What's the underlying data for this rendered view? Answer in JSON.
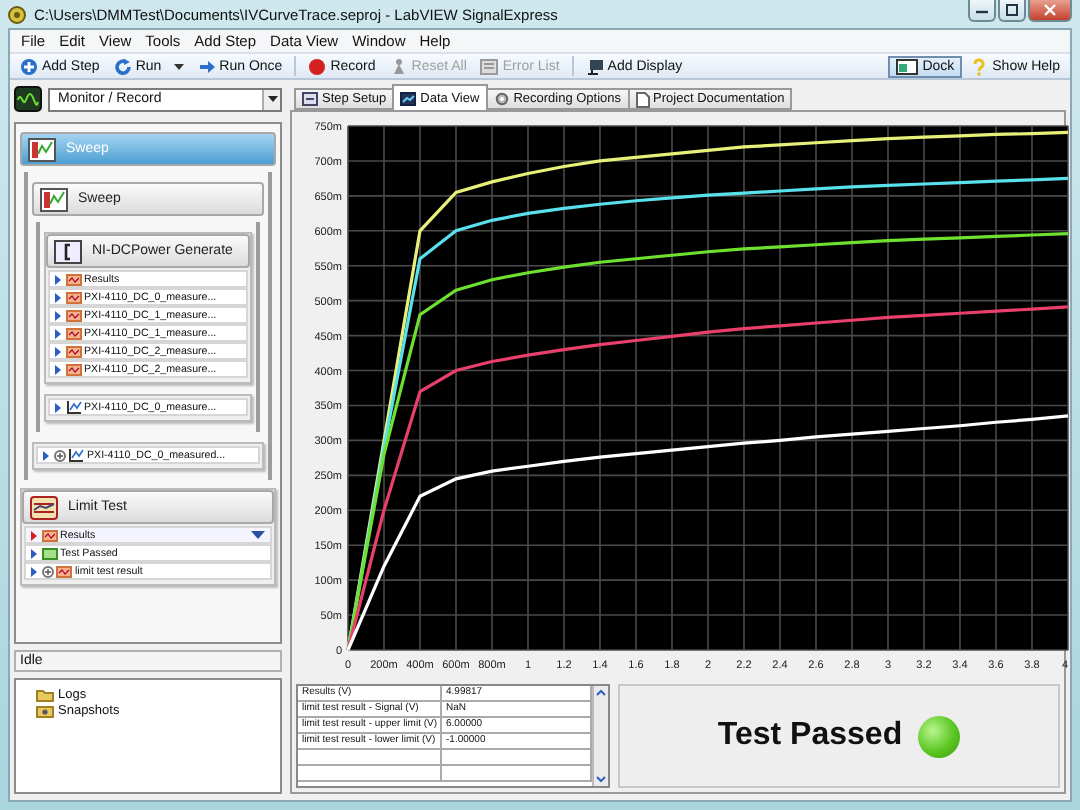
{
  "window": {
    "title": "C:\\Users\\DMMTest\\Documents\\IVCurveTrace.seproj - LabVIEW SignalExpress"
  },
  "menu": [
    "File",
    "Edit",
    "View",
    "Tools",
    "Add Step",
    "Data View",
    "Window",
    "Help"
  ],
  "toolbar": [
    {
      "label": "Add Step",
      "kind": "add",
      "disabled": false,
      "dropdown": false
    },
    {
      "label": "Run",
      "kind": "run",
      "disabled": false,
      "dropdown": true
    },
    {
      "label": "Run Once",
      "kind": "once",
      "disabled": false,
      "dropdown": false
    },
    {
      "label": "Record",
      "kind": "record",
      "disabled": false,
      "dropdown": false
    },
    {
      "label": "Reset All",
      "kind": "reset",
      "disabled": true,
      "dropdown": false
    },
    {
      "label": "Error List",
      "kind": "errors",
      "disabled": true,
      "dropdown": false
    },
    {
      "label": "Add Display",
      "kind": "display",
      "disabled": false,
      "dropdown": false
    }
  ],
  "toolbar_right": [
    {
      "label": "Dock",
      "kind": "dock",
      "pressed": true
    },
    {
      "label": "Show Help",
      "kind": "help",
      "pressed": false
    }
  ],
  "mode": {
    "value": "Monitor / Record"
  },
  "project_tree": {
    "steps": [
      {
        "title": "Sweep",
        "kind": "loop",
        "selected": true,
        "children": [
          {
            "title": "Sweep",
            "kind": "loop",
            "selected": false,
            "children": [
              {
                "title": "NI-DCPower Generate",
                "kind": "dcpower",
                "selected": false,
                "outputs": [
                  {
                    "label": "Results",
                    "kind": "signal",
                    "expandable": false,
                    "selected": false
                  },
                  {
                    "label": "PXI-4110_DC_0_measure...",
                    "kind": "signal",
                    "expandable": false,
                    "selected": false
                  },
                  {
                    "label": "PXI-4110_DC_1_measure...",
                    "kind": "signal",
                    "expandable": false,
                    "selected": false
                  },
                  {
                    "label": "PXI-4110_DC_1_measure...",
                    "kind": "signal",
                    "expandable": false,
                    "selected": false
                  },
                  {
                    "label": "PXI-4110_DC_2_measure...",
                    "kind": "signal",
                    "expandable": false,
                    "selected": false
                  },
                  {
                    "label": "PXI-4110_DC_2_measure...",
                    "kind": "signal",
                    "expandable": false,
                    "selected": false
                  }
                ]
              }
            ],
            "outputs": [
              {
                "label": "PXI-4110_DC_0_measure...",
                "kind": "graph",
                "expandable": false,
                "selected": false
              }
            ]
          }
        ],
        "outputs": [
          {
            "label": "PXI-4110_DC_0_measured...",
            "kind": "graph",
            "expandable": true,
            "selected": false
          }
        ]
      },
      {
        "title": "Limit Test",
        "kind": "limit",
        "selected": false,
        "outputs": [
          {
            "label": "Results",
            "kind": "signal",
            "expandable": false,
            "selected": true
          },
          {
            "label": "Test Passed",
            "kind": "boolean",
            "expandable": false,
            "selected": false
          },
          {
            "label": "limit test result",
            "kind": "signal",
            "expandable": true,
            "selected": false
          }
        ]
      }
    ]
  },
  "status": "Idle",
  "bottom_pane": [
    {
      "label": "Logs",
      "kind": "logs"
    },
    {
      "label": "Snapshots",
      "kind": "snapshots"
    }
  ],
  "tabs": [
    {
      "label": "Step Setup",
      "selected": false
    },
    {
      "label": "Data View",
      "selected": true
    },
    {
      "label": "Recording Options",
      "selected": false
    },
    {
      "label": "Project Documentation",
      "selected": false
    }
  ],
  "chart_data": {
    "type": "line",
    "grid": true,
    "ylim": [
      0,
      750
    ],
    "categories": [
      "0",
      "200m",
      "400m",
      "600m",
      "800m",
      "1",
      "1.2",
      "1.4",
      "1.6",
      "1.8",
      "2",
      "2.2",
      "2.4",
      "2.6",
      "2.8",
      "3",
      "3.2",
      "3.4",
      "3.6",
      "3.8",
      "4"
    ],
    "yticks": [
      0,
      {
        "value": 50,
        "label": "50m"
      },
      {
        "value": 100,
        "label": "100m"
      },
      {
        "value": 150,
        "label": "150m"
      },
      {
        "value": 200,
        "label": "200m"
      },
      {
        "value": 250,
        "label": "250m"
      },
      {
        "value": 300,
        "label": "300m"
      },
      {
        "value": 350,
        "label": "350m"
      },
      {
        "value": 400,
        "label": "400m"
      },
      {
        "value": 450,
        "label": "450m"
      },
      {
        "value": 500,
        "label": "500m"
      },
      {
        "value": 550,
        "label": "550m"
      },
      {
        "value": 600,
        "label": "600m"
      },
      {
        "value": 650,
        "label": "650m"
      },
      {
        "value": 700,
        "label": "700m"
      },
      {
        "value": 750,
        "label": "750m"
      }
    ],
    "series": [
      {
        "color": "#e8f07a",
        "values": [
          0,
          300,
          600,
          655,
          670,
          682,
          692,
          700,
          705,
          710,
          715,
          720,
          723,
          726,
          729,
          732,
          734,
          736,
          738,
          739,
          741
        ]
      },
      {
        "color": "#58e0ec",
        "values": [
          0,
          290,
          560,
          600,
          615,
          625,
          632,
          638,
          643,
          647,
          651,
          654,
          657,
          660,
          663,
          665,
          667,
          669,
          671,
          673,
          675
        ]
      },
      {
        "color": "#6ee030",
        "values": [
          0,
          280,
          480,
          515,
          530,
          540,
          548,
          555,
          560,
          565,
          570,
          574,
          577,
          580,
          583,
          586,
          588,
          590,
          592,
          594,
          596
        ]
      },
      {
        "color": "#e8406a",
        "values": [
          0,
          200,
          370,
          400,
          413,
          422,
          430,
          437,
          443,
          449,
          455,
          460,
          464,
          468,
          472,
          476,
          479,
          482,
          485,
          488,
          491
        ]
      },
      {
        "color": "#ffffff",
        "values": [
          0,
          120,
          220,
          245,
          256,
          263,
          270,
          276,
          281,
          286,
          291,
          296,
          300,
          305,
          309,
          313,
          317,
          321,
          326,
          330,
          335
        ]
      }
    ]
  },
  "results_table": {
    "rows": [
      [
        "Results (V)",
        "4.99817"
      ],
      [
        "limit test result - Signal (V)",
        "NaN"
      ],
      [
        "limit test result - upper limit (V)",
        "6.00000"
      ],
      [
        "limit test result - lower limit (V)",
        "-1.00000"
      ]
    ]
  },
  "indicator": {
    "label": "Test Passed",
    "on": true
  }
}
